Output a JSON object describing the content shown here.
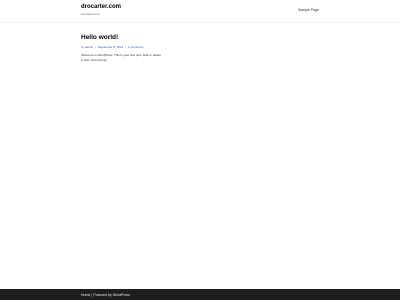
{
  "header": {
    "site_title": "drocarter.com",
    "site_description": "drocarter.com",
    "nav": [
      {
        "label": "Sample Page"
      }
    ]
  },
  "post": {
    "title": "Hello world!",
    "meta": {
      "by": "by",
      "author": "admin",
      "separator": "/",
      "date": "September 8, 2021",
      "comments": "1 Comment"
    },
    "content": "Welcome to WordPress. This is your first post. Edit or delete it, then start writing!"
  },
  "footer": {
    "home_label": "Home",
    "separator": "|",
    "powered": "Powered by WordPress"
  },
  "colors": {
    "footer_background": "#1e1e1e",
    "link": "#3355aa"
  }
}
